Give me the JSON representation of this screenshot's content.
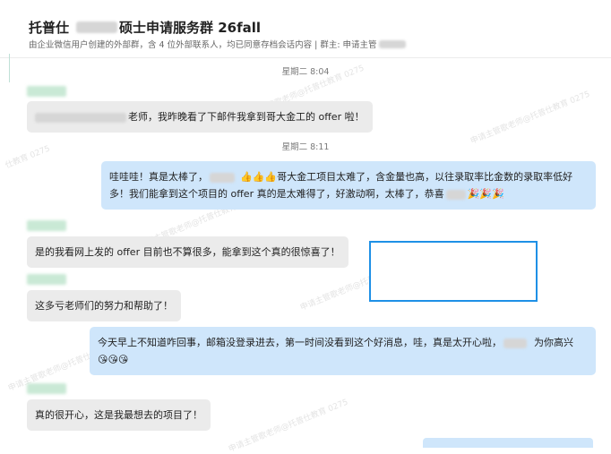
{
  "header": {
    "title_prefix": "托普仕",
    "title_suffix": "硕士申请服务群 26fall",
    "subtitle": "由企业微信用户创建的外部群，含 4 位外部联系人，均已同意存档会话内容 | 群主: 申请主管"
  },
  "timestamps": [
    "星期二 8:04",
    "星期二 8:11"
  ],
  "messages": [
    {
      "type": "incoming",
      "lines": [
        "老师，我昨晚看了下邮件我拿到哥大金工的 offer 啦！"
      ]
    },
    {
      "type": "outgoing",
      "line1_a": "哇哇哇！真是太棒了，",
      "line1_emojis": "👍👍👍",
      "line1_b": "哥大金工项目太难了，含金量也高，以往录取率比金数的录取率低好",
      "line2_a": "多！我们能拿到这个项目的 offer 真的是太难得了，好激动啊，太棒了，恭喜",
      "line2_emojis": "🎉🎉🎉"
    },
    {
      "type": "incoming",
      "lines": [
        "是的我看网上发的 offer 目前也不算很多，能拿到这个真的很惊喜了！"
      ]
    },
    {
      "type": "incoming",
      "lines": [
        "这多亏老师们的努力和帮助了！"
      ]
    },
    {
      "type": "outgoing",
      "line1_a": "今天早上不知道咋回事，邮箱没登录进去，第一时间没看到这个好消息，哇，真是太开心啦，",
      "line1_b": "为你高兴",
      "line2_emojis": "😘😘😘"
    },
    {
      "type": "incoming",
      "lines": [
        "真的很开心，这是我最想去的项目了！"
      ]
    }
  ],
  "watermark": {
    "text_a": "申请主管歌老师@托普仕教育 0275",
    "text_b": "仕教育 0275"
  },
  "colors": {
    "incoming_bubble": "#ebebeb",
    "outgoing_bubble": "#cfe6fb",
    "highlight_border": "#1e90e6"
  }
}
